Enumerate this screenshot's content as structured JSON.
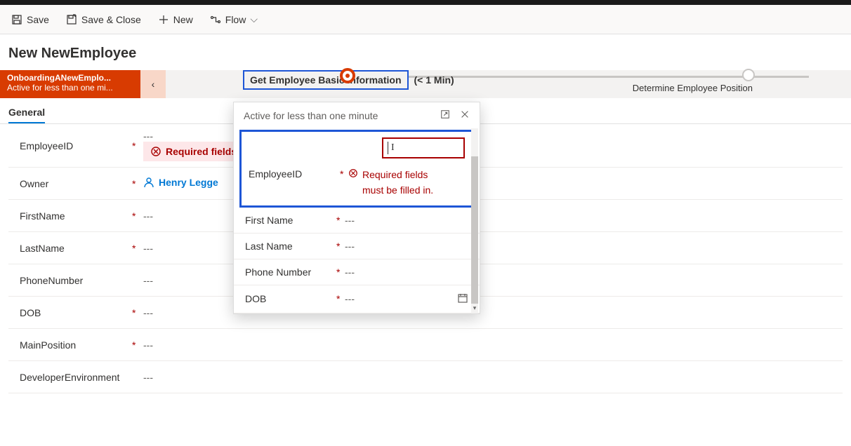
{
  "commandbar": {
    "save": "Save",
    "save_close": "Save & Close",
    "new": "New",
    "flow": "Flow"
  },
  "page": {
    "title": "New NewEmployee"
  },
  "bpf": {
    "stage0": {
      "title": "OnboardingANewEmplo...",
      "subtitle": "Active for less than one mi..."
    },
    "stage1": {
      "label": "Get Employee Basic Information",
      "duration": "(< 1 Min)"
    },
    "stage2": {
      "label": "Determine Employee Position"
    }
  },
  "tabs": {
    "general": "General"
  },
  "form": {
    "employee_id": {
      "label": "EmployeeID",
      "value": "---",
      "error": "Required fields"
    },
    "owner": {
      "label": "Owner",
      "value": "Henry Legge"
    },
    "first_name": {
      "label": "FirstName",
      "value": "---"
    },
    "last_name": {
      "label": "LastName",
      "value": "---"
    },
    "phone": {
      "label": "PhoneNumber",
      "value": "---"
    },
    "dob": {
      "label": "DOB",
      "value": "---"
    },
    "main_position": {
      "label": "MainPosition",
      "value": "---"
    },
    "dev_env": {
      "label": "DeveloperEnvironment",
      "value": "---"
    }
  },
  "flyout": {
    "header": "Active for less than one minute",
    "employee_id": {
      "label": "EmployeeID",
      "error": "Required fields must be filled in."
    },
    "first_name": {
      "label": "First Name",
      "value": "---"
    },
    "last_name": {
      "label": "Last Name",
      "value": "---"
    },
    "phone": {
      "label": "Phone Number",
      "value": "---"
    },
    "dob": {
      "label": "DOB",
      "value": "---"
    }
  }
}
